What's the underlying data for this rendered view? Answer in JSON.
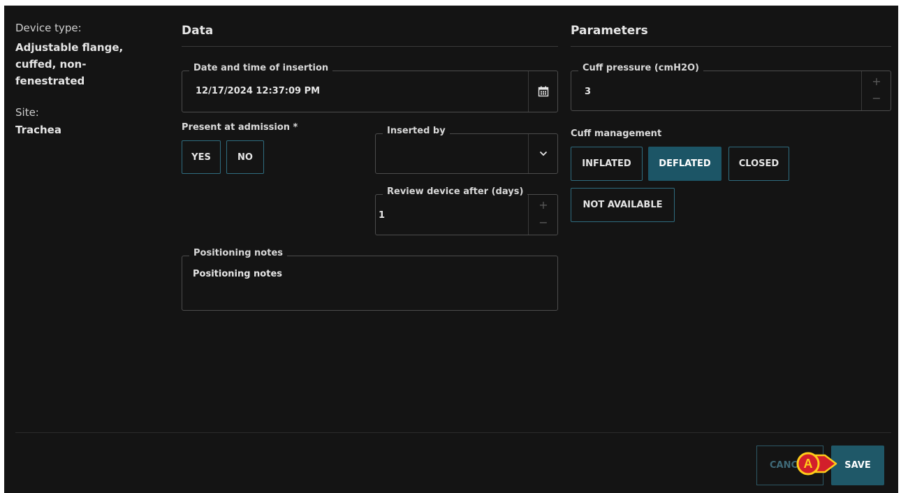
{
  "device_info": {
    "device_type_label": "Device type:",
    "device_type_value_lines": [
      "Adjustable flange,",
      "cuffed, non-",
      "fenestrated"
    ],
    "site_label": "Site:",
    "site_value": "Trachea"
  },
  "data_section": {
    "title": "Data",
    "insertion_datetime": {
      "legend": "Date and time of insertion",
      "value": "12/17/2024 12:37:09 PM",
      "icon": "calendar-icon"
    },
    "present_at_admission": {
      "label": "Present at admission *",
      "options": [
        "YES",
        "NO"
      ]
    },
    "inserted_by": {
      "legend": "Inserted by",
      "value": "",
      "icon": "chevron-down-icon"
    },
    "review_after": {
      "legend": "Review device after (days)",
      "value": "1",
      "plus": "+",
      "minus": "−"
    },
    "positioning_notes": {
      "legend": "Positioning notes",
      "value": "Positioning notes"
    }
  },
  "parameters_section": {
    "title": "Parameters",
    "cuff_pressure": {
      "legend": "Cuff pressure (cmH2O)",
      "value": "3",
      "plus": "+",
      "minus": "−"
    },
    "cuff_management": {
      "label": "Cuff management",
      "options": [
        "INFLATED",
        "DEFLATED",
        "CLOSED",
        "NOT AVAILABLE"
      ],
      "selected": "DEFLATED"
    }
  },
  "footer": {
    "cancel_label": "CANCEL",
    "save_label": "SAVE",
    "callout_letter": "A"
  },
  "colors": {
    "background": "#141414",
    "accent": "#1c5566",
    "button_border": "#2f6d80",
    "callout_red": "#d21f2b",
    "callout_yellow": "#ffcc1a"
  }
}
